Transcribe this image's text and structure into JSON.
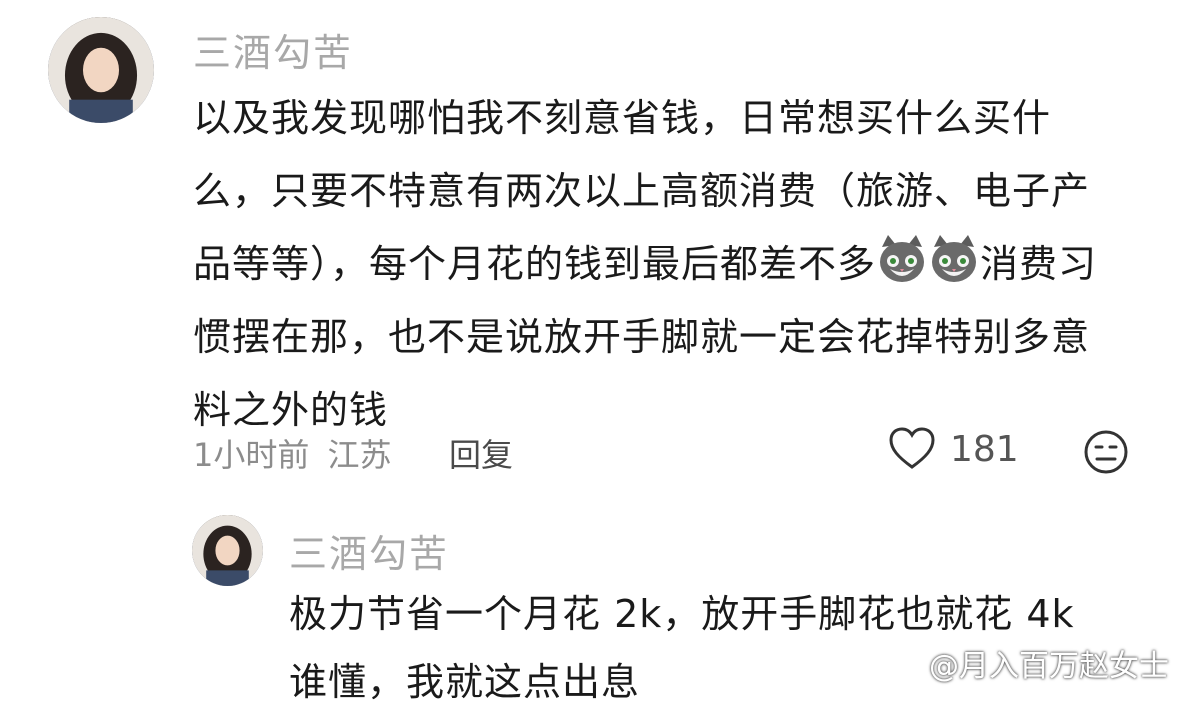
{
  "comment": {
    "username": "三酒勾苦",
    "text_part1": "以及我发现哪怕我不刻意省钱，日常想买什么买什么，只要不特意有两次以上高额消费（旅游、电子产品等等），每个月花的钱到最后都差不多",
    "text_part2": "消费习惯摆在那，也不是说放开手脚就一定会花掉特别多意料之外的钱",
    "time": "1小时前",
    "location": "江苏",
    "reply_label": "回复",
    "like_count": "181"
  },
  "reply": {
    "username": "三酒勾苦",
    "text": "极力节省一个月花 2k，放开手脚花也就花 4k\n谁懂，我就这点出息"
  },
  "watermark": {
    "text": "@月入百万赵女士"
  },
  "icons": {
    "like": "heart-outline-icon",
    "reaction": "neutral-face-icon",
    "emoji": "gray-cat-face-icon",
    "watermark_logo": "weibo-icon"
  },
  "colors": {
    "username": "#a8a8a8",
    "body": "#1a1a1a",
    "meta": "#8c8c8c"
  }
}
